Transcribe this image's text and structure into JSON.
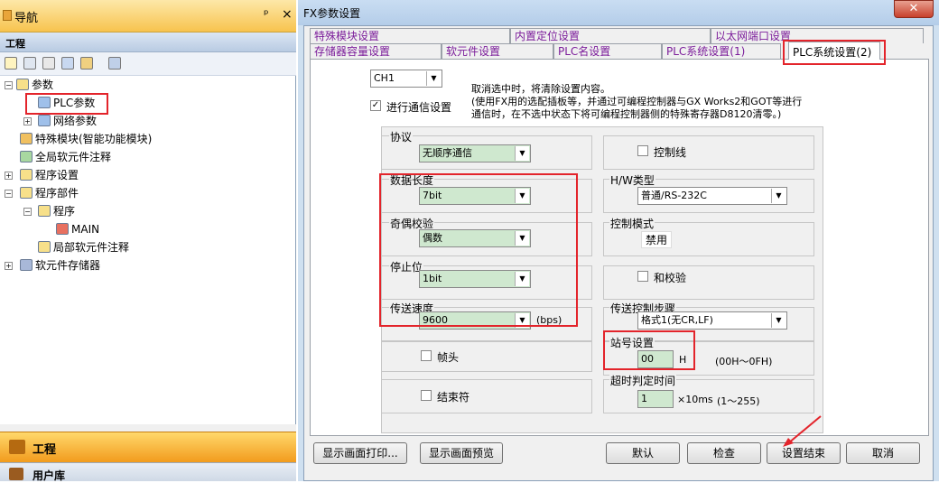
{
  "nav": {
    "title": "导航",
    "pin": "ᵖ",
    "close": "×",
    "section": "工程",
    "tree": {
      "params": "参数",
      "plc_params": "PLC参数",
      "network_params": "网络参数",
      "special_module": "特殊模块(智能功能模块)",
      "global_comment": "全局软元件注释",
      "program_settings": "程序设置",
      "program_parts": "程序部件",
      "program": "程序",
      "main": "MAIN",
      "local_comment": "局部软元件注释",
      "device_memory": "软元件存储器"
    },
    "bottom_tab_1": "工程",
    "bottom_tab_2": "用户库"
  },
  "dialog": {
    "title": "FX参数设置",
    "close": "✕",
    "tabs_row1": [
      "特殊模块设置",
      "内置定位设置",
      "以太网端口设置"
    ],
    "tabs_row2": [
      "存储器容量设置",
      "软元件设置",
      "PLC名设置",
      "PLC系统设置(1)",
      "PLC系统设置(2)"
    ],
    "channel": "CH1",
    "comm_checkbox": "进行通信设置",
    "comm_checked": true,
    "note": [
      "取消选中时，将清除设置内容。",
      "(使用FX用的选配插板等，并通过可编程控制器与GX Works2和GOT等进行",
      "通信时，在不选中状态下将可编程控制器侧的特殊寄存器D8120清零。)"
    ],
    "protocol": {
      "label": "协议",
      "value": "无顺序通信"
    },
    "data_length": {
      "label": "数据长度",
      "value": "7bit"
    },
    "parity": {
      "label": "奇偶校验",
      "value": "偶数"
    },
    "stop_bit": {
      "label": "停止位",
      "value": "1bit"
    },
    "baud": {
      "label": "传送速度",
      "value": "9600",
      "unit": "(bps)"
    },
    "header": {
      "label": "帧头"
    },
    "terminator": {
      "label": "结束符"
    },
    "control_line": {
      "label": "控制线"
    },
    "hw_type": {
      "label": "H/W类型",
      "value": "普通/RS-232C"
    },
    "control_mode": {
      "label": "控制模式",
      "value": "禁用"
    },
    "sum_check": {
      "label": "和校验"
    },
    "transfer_procedure": {
      "label": "传送控制步骤",
      "value": "格式1(无CR,LF)"
    },
    "station": {
      "label": "站号设置",
      "value": "00",
      "suffix": "H",
      "range": "(00H～0FH)"
    },
    "timeout": {
      "label": "超时判定时间",
      "value": "1",
      "unit": "×10ms",
      "range": "(1～255)"
    },
    "buttons": {
      "print": "显示画面打印...",
      "preview": "显示画面预览",
      "default": "默认",
      "check": "检查",
      "finish": "设置结束",
      "cancel": "取消"
    }
  }
}
